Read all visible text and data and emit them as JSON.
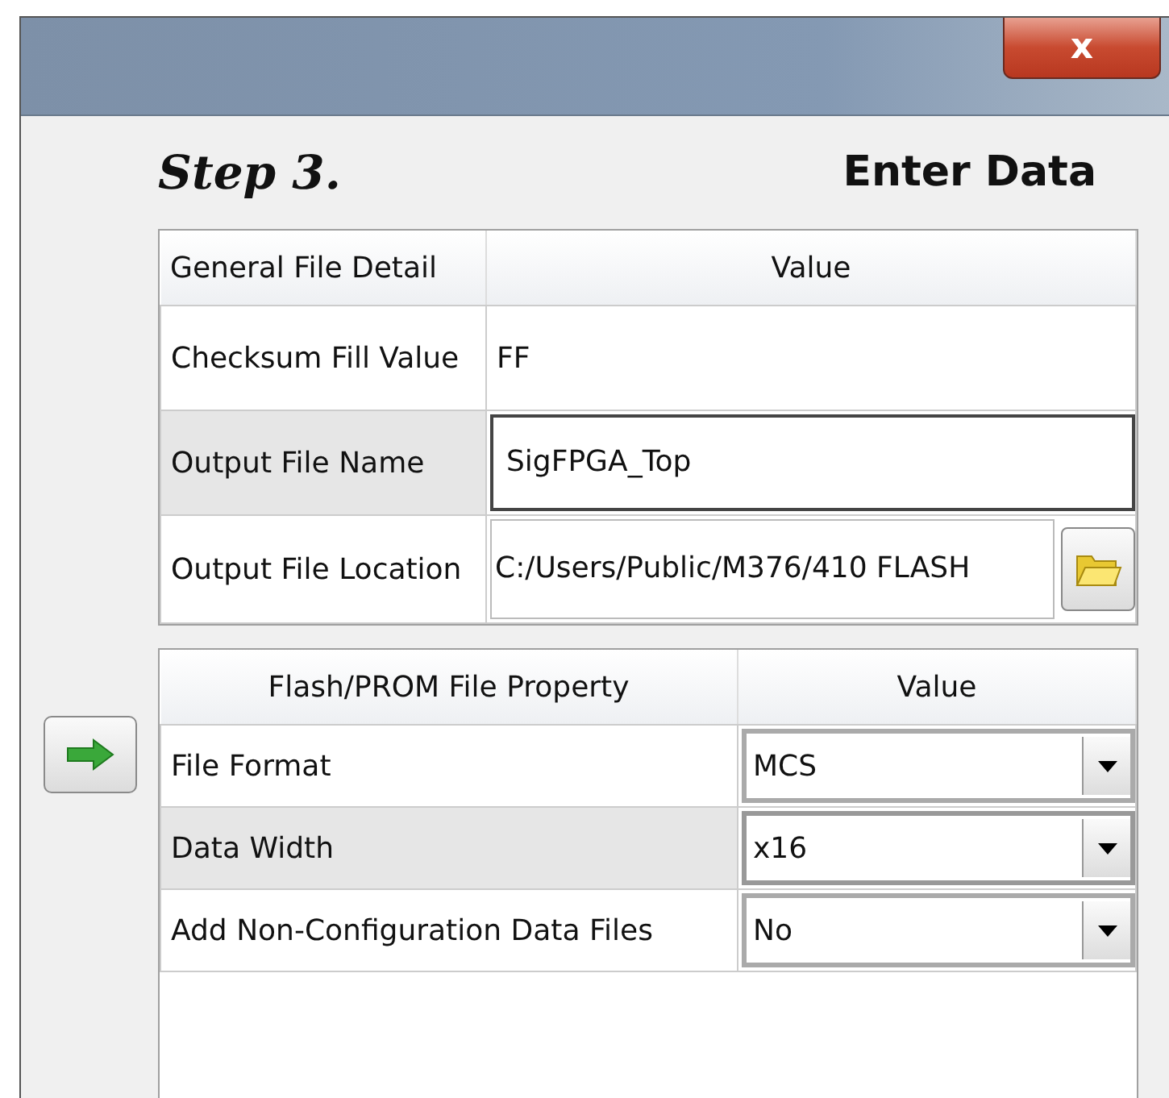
{
  "window": {
    "close_label": "x"
  },
  "step": {
    "number": "Step 3.",
    "title": "Enter Data"
  },
  "general_table": {
    "columns": [
      "General File Detail",
      "Value"
    ],
    "rows": [
      {
        "kind": "text",
        "label": "Checksum Fill Value",
        "value": "FF",
        "selected": false
      },
      {
        "kind": "field",
        "label": "Output File Name",
        "value": "SigFPGA_Top",
        "selected": true
      },
      {
        "kind": "path",
        "label": "Output File Location",
        "value": "C:/Users/Public/M376/410 FLASH",
        "selected": false
      }
    ]
  },
  "prom_table": {
    "columns": [
      "Flash/PROM File Property",
      "Value"
    ],
    "rows": [
      {
        "label": "File Format",
        "value": "MCS",
        "selected": false
      },
      {
        "label": "Data Width",
        "value": "x16",
        "selected": true
      },
      {
        "label": "Add Non-Configuration Data Files",
        "value": "No",
        "selected": false
      }
    ]
  }
}
